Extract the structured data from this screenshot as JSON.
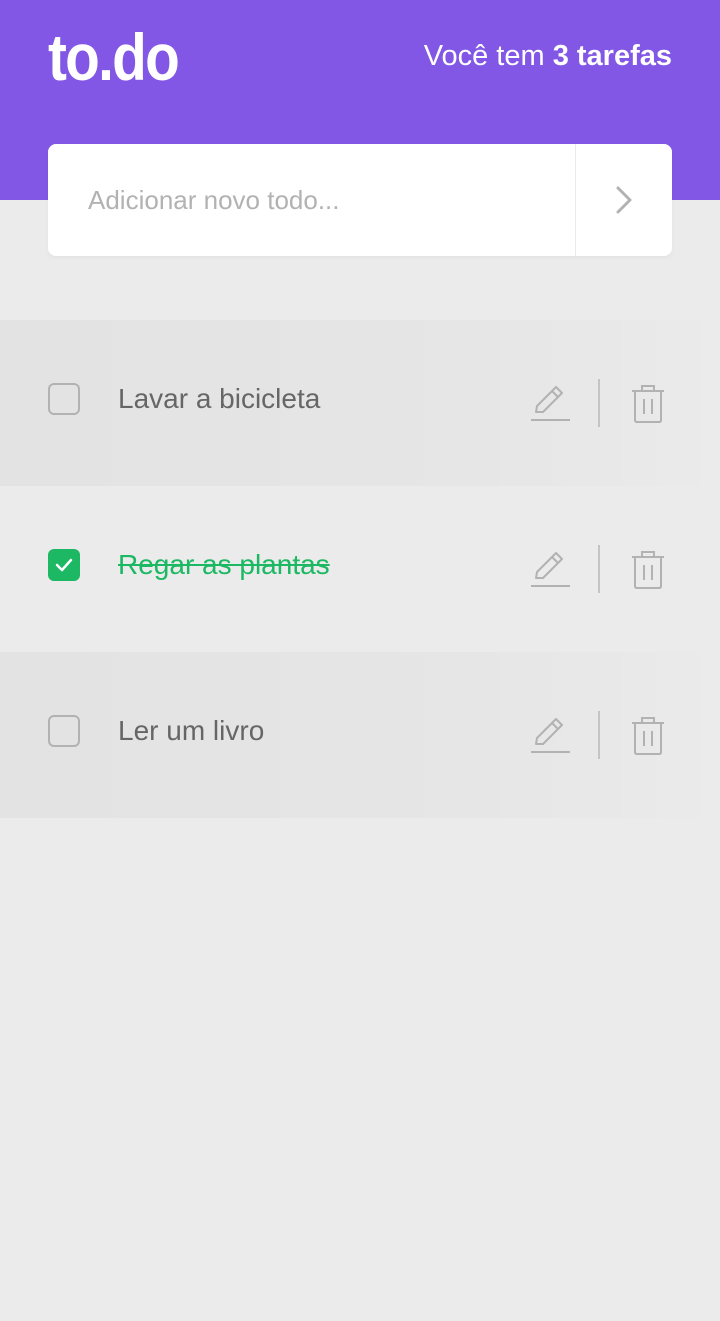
{
  "header": {
    "logo": "to.do",
    "counter_prefix": "Você tem ",
    "counter_strong": "3 tarefas"
  },
  "new_todo": {
    "placeholder": "Adicionar novo todo...",
    "submit_icon": "chevron-right-icon"
  },
  "tasks": [
    {
      "title": "Lavar a bicicleta",
      "done": false
    },
    {
      "title": "Regar as plantas",
      "done": true
    },
    {
      "title": "Ler um livro",
      "done": false
    }
  ],
  "colors": {
    "primary": "#8257E5",
    "background": "#EBEBEB",
    "done": "#1DB863",
    "text": "#666666",
    "icon": "#B2B2B2"
  }
}
